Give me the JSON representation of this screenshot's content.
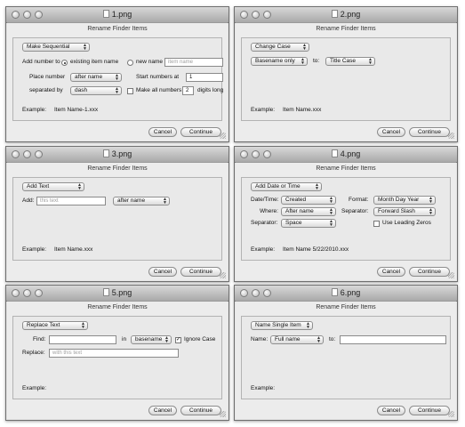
{
  "dialog_title": "Rename Finder Items",
  "buttons": {
    "cancel": "Cancel",
    "continue": "Continue"
  },
  "example_label": "Example:",
  "windows": [
    {
      "title": "1.png",
      "mode": "Make Sequential",
      "add_number_to": "Add number to",
      "existing_item_name": "existing item name",
      "new_name": "new name",
      "new_name_placeholder": "item name",
      "place_number": "Place number",
      "place_number_value": "after name",
      "start_numbers_at": "Start numbers at",
      "start_value": "1",
      "separated_by": "separated by",
      "separator_value": "dash",
      "make_all_numbers": "Make all numbers",
      "digits_value": "2",
      "digits_long": "digits long",
      "example_value": "Item Name-1.xxx"
    },
    {
      "title": "2.png",
      "mode": "Change Case",
      "target": "Basename only",
      "to": "to:",
      "case": "Title Case",
      "example_value": "Item Name.xxx"
    },
    {
      "title": "3.png",
      "mode": "Add Text",
      "add": "Add:",
      "text_placeholder": "this text",
      "position": "after name",
      "example_value": "Item Name.xxx"
    },
    {
      "title": "4.png",
      "mode": "Add Date or Time",
      "date_time_label": "Date/Time:",
      "date_time_value": "Created",
      "where_label": "Where:",
      "where_value": "After name",
      "separator_label": "Separator:",
      "separator_value": "Space",
      "format_label": "Format:",
      "format_value": "Month Day Year",
      "separator2_label": "Separator:",
      "separator2_value": "Forward Slash",
      "leading_zeros": "Use Leading Zeros",
      "example_value": "Item Name 5/22/2010.xxx"
    },
    {
      "title": "5.png",
      "mode": "Replace Text",
      "find": "Find:",
      "in": "in",
      "in_value": "basename only",
      "ignore_case": "Ignore Case",
      "replace": "Replace:",
      "replace_placeholder": "with this text",
      "example_value": ""
    },
    {
      "title": "6.png",
      "mode": "Name Single Item",
      "name_label": "Name:",
      "name_value": "Full name",
      "to": "to:",
      "example_value": ""
    }
  ]
}
